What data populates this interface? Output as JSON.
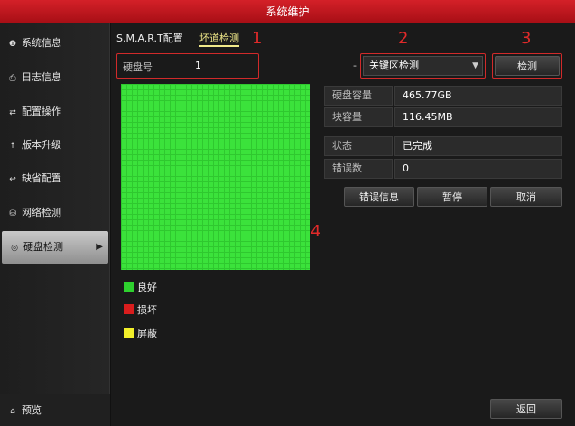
{
  "window": {
    "title": "系统维护"
  },
  "sidebar": {
    "items": [
      {
        "label": "系统信息",
        "icon": "info-icon",
        "glyph": "❶"
      },
      {
        "label": "日志信息",
        "icon": "log-icon",
        "glyph": "⎙"
      },
      {
        "label": "配置操作",
        "icon": "config-icon",
        "glyph": "⇄"
      },
      {
        "label": "版本升级",
        "icon": "upgrade-icon",
        "glyph": "↑"
      },
      {
        "label": "缺省配置",
        "icon": "default-icon",
        "glyph": "↩"
      },
      {
        "label": "网络检测",
        "icon": "network-icon",
        "glyph": "⛁"
      },
      {
        "label": "硬盘检测",
        "icon": "disk-icon",
        "glyph": "◎",
        "active": true
      }
    ],
    "preview_label": "预览",
    "preview_icon": "home-icon"
  },
  "tabs": [
    {
      "label": "S.M.A.R.T配置"
    },
    {
      "label": "坏道检测",
      "active": true
    }
  ],
  "annotations": [
    "1",
    "2",
    "3",
    "4"
  ],
  "disk": {
    "label": "硬盘号",
    "value": "1"
  },
  "scan_type": {
    "value": "关键区检测",
    "arrow": "-"
  },
  "detect_button": "检测",
  "info": [
    {
      "label": "硬盘容量",
      "value": "465.77GB"
    },
    {
      "label": "块容量",
      "value": "116.45MB"
    },
    {
      "label": "状态",
      "value": "已完成"
    },
    {
      "label": "错误数",
      "value": "0"
    }
  ],
  "actions": {
    "error_info": "错误信息",
    "pause": "暂停",
    "cancel": "取消"
  },
  "legend": [
    {
      "label": "良好",
      "color": "#2ed12e"
    },
    {
      "label": "损坏",
      "color": "#d91d1d"
    },
    {
      "label": "屏蔽",
      "color": "#f2ef2a"
    }
  ],
  "back_button": "返回",
  "colors": {
    "title_bar": "#c8141c",
    "highlight": "#e02a2a",
    "good_block": "#3be23b"
  }
}
